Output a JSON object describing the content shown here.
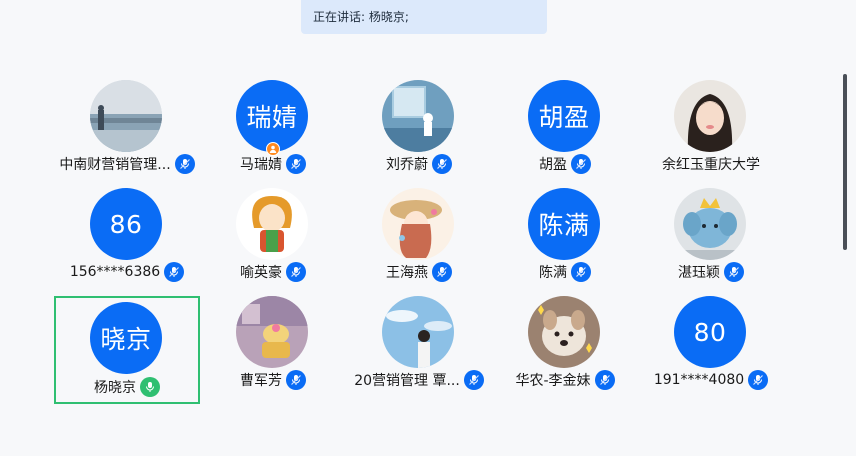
{
  "banner": {
    "text": "正在讲话: 杨晓京;"
  },
  "colors": {
    "brand_blue": "#0a6cf5",
    "speaking_green": "#2fbf71",
    "host_orange": "#ff8a1f"
  },
  "participants": [
    {
      "name": "中南财营销管理...",
      "avatar": "photo-bridge-sea"
    },
    {
      "name": "马瑞婧",
      "initials": "瑞婧",
      "host": true
    },
    {
      "name": "刘乔蔚",
      "avatar": "illustration-room"
    },
    {
      "name": "胡盈",
      "initials": "胡盈"
    },
    {
      "name": "余红玉重庆大学",
      "avatar": "photo-girl-portrait",
      "no_mic": true
    },
    {
      "name": "156****6386",
      "initials": "86"
    },
    {
      "name": "喻英豪",
      "avatar": "cartoon-character"
    },
    {
      "name": "王海燕",
      "avatar": "illustration-girl-hat"
    },
    {
      "name": "陈满",
      "initials": "陈满"
    },
    {
      "name": "湛珏颖",
      "avatar": "plush-toy-elephant"
    },
    {
      "name": "杨晓京",
      "initials": "晓京",
      "speaking": true,
      "selected": true
    },
    {
      "name": "曹军芳",
      "avatar": "cartoon-room"
    },
    {
      "name": "20营销管理 覃...",
      "avatar": "photo-boy-sky"
    },
    {
      "name": "华农-李金妹",
      "avatar": "photo-dog"
    },
    {
      "name": "191****4080",
      "initials": "80"
    }
  ]
}
